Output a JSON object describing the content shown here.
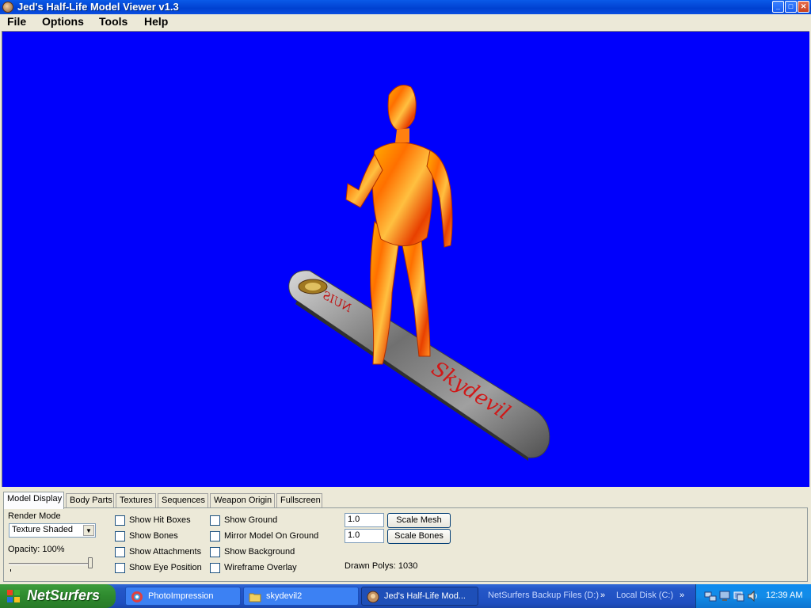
{
  "window": {
    "title": "Jed's Half-Life Model Viewer v1.3"
  },
  "menu": [
    "File",
    "Options",
    "Tools",
    "Help"
  ],
  "tabs": [
    "Model Display",
    "Body Parts",
    "Textures",
    "Sequences",
    "Weapon Origin",
    "Fullscreen"
  ],
  "render_mode": {
    "label": "Render Mode",
    "value": "Texture Shaded"
  },
  "opacity": {
    "label": "Opacity: 100%",
    "value": 100
  },
  "checkboxes": {
    "col1": [
      "Show Hit Boxes",
      "Show Bones",
      "Show Attachments",
      "Show Eye Position"
    ],
    "col2": [
      "Show Ground",
      "Mirror Model On Ground",
      "Show Background",
      "Wireframe Overlay"
    ]
  },
  "scale": {
    "mesh_value": "1.0",
    "bones_value": "1.0",
    "mesh_button": "Scale Mesh",
    "bones_button": "Scale Bones"
  },
  "drawn_polys": "Drawn Polys: 1030",
  "board_text": "Skydevil",
  "board_text_mirrored": "NUIS",
  "viewport_color": "#0000fc",
  "taskbar": {
    "start": "NetSurfers",
    "tasks": [
      "PhotoImpression",
      "skydevil2",
      "Jed's Half-Life Mod..."
    ],
    "quick": [
      "NetSurfers Backup Files (D:)",
      "Local Disk (C:)"
    ],
    "clock": "12:39 AM"
  }
}
